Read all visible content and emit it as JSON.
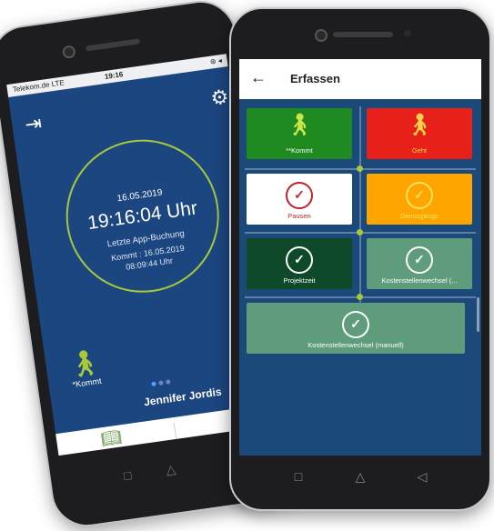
{
  "back_phone": {
    "status": {
      "carrier": "Telekom.de  LTE",
      "time": "19:16",
      "battery": "⊛ ◂"
    },
    "clock": {
      "date": "16.05.2019",
      "time": "19:16:04 Uhr",
      "last_booking_label": "Letzte App-Buchung",
      "kommt_line": "Kommt : 16.05.2019",
      "kommt_time": "08:09:44 Uhr"
    },
    "kommt_label": "*Kommt",
    "user_name": "Jennifer Jordis",
    "nav": {
      "buchungen_label": "Buchungen"
    },
    "softkeys": {
      "back": "◁",
      "home": "△",
      "recent": "□"
    }
  },
  "front_phone": {
    "appbar": {
      "back_glyph": "←",
      "title": "Erfassen"
    },
    "tiles": [
      {
        "label": "**Kommt",
        "bg": "#1f8a1f",
        "fg": "#ffffff",
        "icon_color": "#c8e64a",
        "icon": "walker-icon"
      },
      {
        "label": "Geht",
        "bg": "#e8201a",
        "fg": "#f4d24a",
        "icon_color": "#f4d24a",
        "icon": "walker-icon"
      },
      {
        "label": "Pausen",
        "bg": "#ffffff",
        "fg": "#c0232b",
        "icon_color": "#c0232b",
        "icon": "check-circle-icon"
      },
      {
        "label": "Dienstgänge",
        "bg": "#ffa500",
        "fg": "#ffe15a",
        "icon_color": "#ffe15a",
        "icon": "check-circle-icon"
      },
      {
        "label": "Projektzeit",
        "bg": "#0e4a2a",
        "fg": "#ffffff",
        "icon_color": "#ffffff",
        "icon": "check-circle-icon"
      },
      {
        "label": "Kostenstellenwechsel (...",
        "bg": "#5e9c7c",
        "fg": "#ffffff",
        "icon_color": "#ffffff",
        "icon": "check-circle-icon"
      },
      {
        "label": "Kostenstellenwechsel (manuell)",
        "bg": "#5e9c7c",
        "fg": "#ffffff",
        "icon_color": "#ffffff",
        "icon": "check-circle-icon"
      }
    ],
    "softkeys": {
      "recent": "□",
      "home": "△",
      "back": "◁"
    }
  }
}
